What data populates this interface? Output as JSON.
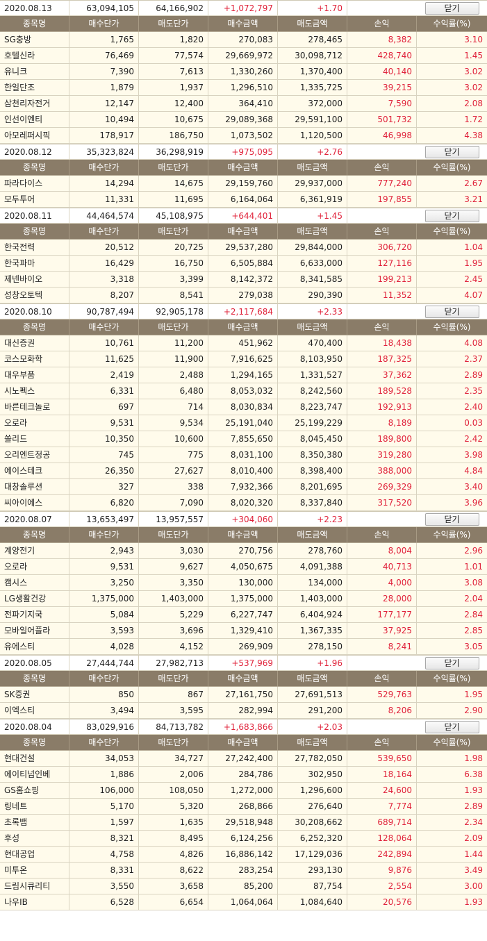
{
  "headers": [
    "종목명",
    "매수단가",
    "매도단가",
    "매수금액",
    "매도금액",
    "손익",
    "수익률(%)"
  ],
  "close_label": "닫기",
  "groups": [
    {
      "date": "2020.08.13",
      "buy_total": "63,094,105",
      "sell_total": "64,166,902",
      "profit": "+1,072,797",
      "rate": "+1.70",
      "rows": [
        [
          "SG충방",
          "1,765",
          "1,820",
          "270,083",
          "278,465",
          "8,382",
          "3.10"
        ],
        [
          "호텔신라",
          "76,469",
          "77,574",
          "29,669,972",
          "30,098,712",
          "428,740",
          "1.45"
        ],
        [
          "유니크",
          "7,390",
          "7,613",
          "1,330,260",
          "1,370,400",
          "40,140",
          "3.02"
        ],
        [
          "한일단조",
          "1,879",
          "1,937",
          "1,296,510",
          "1,335,725",
          "39,215",
          "3.02"
        ],
        [
          "삼천리자전거",
          "12,147",
          "12,400",
          "364,410",
          "372,000",
          "7,590",
          "2.08"
        ],
        [
          "인선이엔티",
          "10,494",
          "10,675",
          "29,089,368",
          "29,591,100",
          "501,732",
          "1.72"
        ],
        [
          "아모레퍼시픽",
          "178,917",
          "186,750",
          "1,073,502",
          "1,120,500",
          "46,998",
          "4.38"
        ]
      ]
    },
    {
      "date": "2020.08.12",
      "buy_total": "35,323,824",
      "sell_total": "36,298,919",
      "profit": "+975,095",
      "rate": "+2.76",
      "rows": [
        [
          "파라다이스",
          "14,294",
          "14,675",
          "29,159,760",
          "29,937,000",
          "777,240",
          "2.67"
        ],
        [
          "모두투어",
          "11,331",
          "11,695",
          "6,164,064",
          "6,361,919",
          "197,855",
          "3.21"
        ]
      ]
    },
    {
      "date": "2020.08.11",
      "buy_total": "44,464,574",
      "sell_total": "45,108,975",
      "profit": "+644,401",
      "rate": "+1.45",
      "rows": [
        [
          "한국전력",
          "20,512",
          "20,725",
          "29,537,280",
          "29,844,000",
          "306,720",
          "1.04"
        ],
        [
          "한국파마",
          "16,429",
          "16,750",
          "6,505,884",
          "6,633,000",
          "127,116",
          "1.95"
        ],
        [
          "제넨바이오",
          "3,318",
          "3,399",
          "8,142,372",
          "8,341,585",
          "199,213",
          "2.45"
        ],
        [
          "성창오토텍",
          "8,207",
          "8,541",
          "279,038",
          "290,390",
          "11,352",
          "4.07"
        ]
      ]
    },
    {
      "date": "2020.08.10",
      "buy_total": "90,787,494",
      "sell_total": "92,905,178",
      "profit": "+2,117,684",
      "rate": "+2.33",
      "rows": [
        [
          "대신증권",
          "10,761",
          "11,200",
          "451,962",
          "470,400",
          "18,438",
          "4.08"
        ],
        [
          "코스모화학",
          "11,625",
          "11,900",
          "7,916,625",
          "8,103,950",
          "187,325",
          "2.37"
        ],
        [
          "대우부품",
          "2,419",
          "2,488",
          "1,294,165",
          "1,331,527",
          "37,362",
          "2.89"
        ],
        [
          "시노펙스",
          "6,331",
          "6,480",
          "8,053,032",
          "8,242,560",
          "189,528",
          "2.35"
        ],
        [
          "바른테크놀로",
          "697",
          "714",
          "8,030,834",
          "8,223,747",
          "192,913",
          "2.40"
        ],
        [
          "오로라",
          "9,531",
          "9,534",
          "25,191,040",
          "25,199,229",
          "8,189",
          "0.03"
        ],
        [
          "쏠리드",
          "10,350",
          "10,600",
          "7,855,650",
          "8,045,450",
          "189,800",
          "2.42"
        ],
        [
          "오리엔트정공",
          "745",
          "775",
          "8,031,100",
          "8,350,380",
          "319,280",
          "3.98"
        ],
        [
          "에이스테크",
          "26,350",
          "27,627",
          "8,010,400",
          "8,398,400",
          "388,000",
          "4.84"
        ],
        [
          "대창솔루션",
          "327",
          "338",
          "7,932,366",
          "8,201,695",
          "269,329",
          "3.40"
        ],
        [
          "씨아이에스",
          "6,820",
          "7,090",
          "8,020,320",
          "8,337,840",
          "317,520",
          "3.96"
        ]
      ]
    },
    {
      "date": "2020.08.07",
      "buy_total": "13,653,497",
      "sell_total": "13,957,557",
      "profit": "+304,060",
      "rate": "+2.23",
      "rows": [
        [
          "계양전기",
          "2,943",
          "3,030",
          "270,756",
          "278,760",
          "8,004",
          "2.96"
        ],
        [
          "오로라",
          "9,531",
          "9,627",
          "4,050,675",
          "4,091,388",
          "40,713",
          "1.01"
        ],
        [
          "캠시스",
          "3,250",
          "3,350",
          "130,000",
          "134,000",
          "4,000",
          "3.08"
        ],
        [
          "LG생활건강",
          "1,375,000",
          "1,403,000",
          "1,375,000",
          "1,403,000",
          "28,000",
          "2.04"
        ],
        [
          "전파기지국",
          "5,084",
          "5,229",
          "6,227,747",
          "6,404,924",
          "177,177",
          "2.84"
        ],
        [
          "모바일어플라",
          "3,593",
          "3,696",
          "1,329,410",
          "1,367,335",
          "37,925",
          "2.85"
        ],
        [
          "유에스티",
          "4,028",
          "4,152",
          "269,909",
          "278,150",
          "8,241",
          "3.05"
        ]
      ]
    },
    {
      "date": "2020.08.05",
      "buy_total": "27,444,744",
      "sell_total": "27,982,713",
      "profit": "+537,969",
      "rate": "+1.96",
      "rows": [
        [
          "SK증권",
          "850",
          "867",
          "27,161,750",
          "27,691,513",
          "529,763",
          "1.95"
        ],
        [
          "이엑스티",
          "3,494",
          "3,595",
          "282,994",
          "291,200",
          "8,206",
          "2.90"
        ]
      ]
    },
    {
      "date": "2020.08.04",
      "buy_total": "83,029,916",
      "sell_total": "84,713,782",
      "profit": "+1,683,866",
      "rate": "+2.03",
      "rows": [
        [
          "현대건설",
          "34,053",
          "34,727",
          "27,242,400",
          "27,782,050",
          "539,650",
          "1.98"
        ],
        [
          "에이티넘인베",
          "1,886",
          "2,006",
          "284,786",
          "302,950",
          "18,164",
          "6.38"
        ],
        [
          "GS홈쇼핑",
          "106,000",
          "108,050",
          "1,272,000",
          "1,296,600",
          "24,600",
          "1.93"
        ],
        [
          "링네트",
          "5,170",
          "5,320",
          "268,866",
          "276,640",
          "7,774",
          "2.89"
        ],
        [
          "초록뱀",
          "1,597",
          "1,635",
          "29,518,948",
          "30,208,662",
          "689,714",
          "2.34"
        ],
        [
          "후성",
          "8,321",
          "8,495",
          "6,124,256",
          "6,252,320",
          "128,064",
          "2.09"
        ],
        [
          "현대공업",
          "4,758",
          "4,826",
          "16,886,142",
          "17,129,036",
          "242,894",
          "1.44"
        ],
        [
          "미투온",
          "8,331",
          "8,622",
          "283,254",
          "293,130",
          "9,876",
          "3.49"
        ],
        [
          "드림시큐리티",
          "3,550",
          "3,658",
          "85,200",
          "87,754",
          "2,554",
          "3.00"
        ],
        [
          "나우IB",
          "6,528",
          "6,654",
          "1,064,064",
          "1,084,640",
          "20,576",
          "1.93"
        ]
      ]
    }
  ]
}
